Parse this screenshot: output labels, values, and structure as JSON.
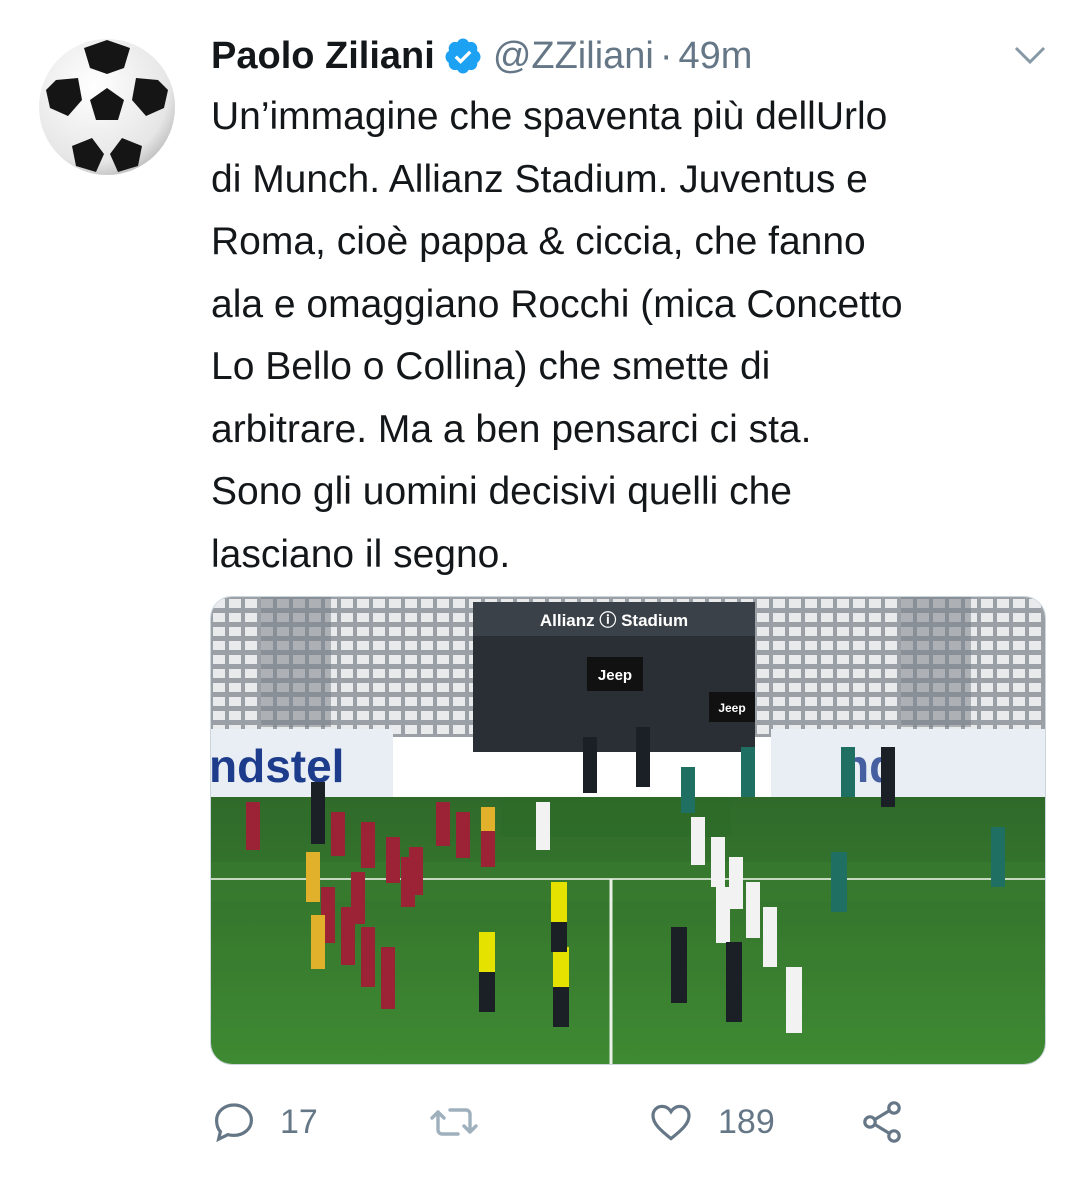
{
  "tweet": {
    "author_name": "Paolo Ziliani",
    "handle": "@ZZiliani",
    "separator": "·",
    "time": "49m",
    "avatar_icon": "soccer-ball-icon",
    "text_lines": [
      "Un’immagine che spaventa più dellUrlo",
      "di Munch. Allianz Stadium. Juventus e",
      "Roma, cioè pappa & ciccia, che fanno",
      "ala e omaggiano Rocchi (mica Concetto",
      "Lo Bello o Collina) che smette di",
      "arbitrare. Ma a ben pensarci ci sta.",
      "Sono gli uomini decisivi quelli che",
      "lasciano il segno."
    ]
  },
  "media": {
    "stadium_sign": "Allianz ⓘ Stadium",
    "sponsor_label": "Jeep",
    "sponsor_label_2": "Jeep",
    "ad_board_left": "ndstel",
    "ad_board_right": "nd"
  },
  "actions": {
    "reply_count": "17",
    "retweet_count": "",
    "like_count": "189"
  },
  "colors": {
    "text": "#14171a",
    "secondary": "#657786",
    "verified": "#1da1f2"
  }
}
